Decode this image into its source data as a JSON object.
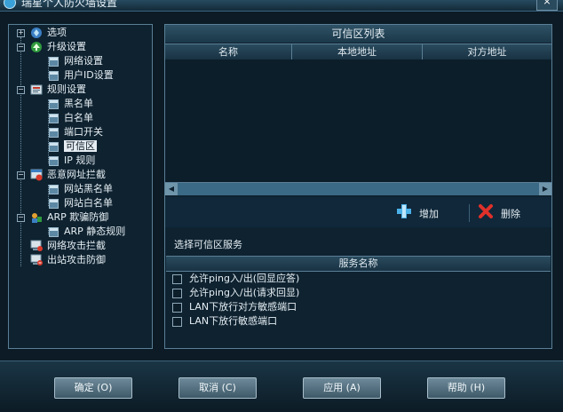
{
  "window": {
    "title": "瑞星个人防火墙设置",
    "close_label": "×"
  },
  "tree": {
    "items": [
      {
        "label": "选项",
        "expander": "+"
      },
      {
        "label": "升级设置",
        "expander": "−"
      },
      {
        "label": "网络设置"
      },
      {
        "label": "用户ID设置"
      },
      {
        "label": "规则设置",
        "expander": "−"
      },
      {
        "label": "黑名单"
      },
      {
        "label": "白名单"
      },
      {
        "label": "端口开关"
      },
      {
        "label": "可信区"
      },
      {
        "label": "IP 规则"
      },
      {
        "label": "恶意网址拦截",
        "expander": "−"
      },
      {
        "label": "网站黑名单"
      },
      {
        "label": "网站白名单"
      },
      {
        "label": "ARP 欺骗防御",
        "expander": "−"
      },
      {
        "label": "ARP 静态规则"
      },
      {
        "label": "网络攻击拦截"
      },
      {
        "label": "出站攻击防御"
      }
    ]
  },
  "trusted_list": {
    "title": "可信区列表",
    "columns": [
      "名称",
      "本地地址",
      "对方地址"
    ]
  },
  "actions": {
    "add_label": "增加",
    "delete_label": "删除"
  },
  "services": {
    "title": "选择可信区服务",
    "header": "服务名称",
    "items": [
      {
        "label": "允许ping入/出(回显应答)",
        "checked": false
      },
      {
        "label": "允许ping入/出(请求回显)",
        "checked": false
      },
      {
        "label": "LAN下放行对方敏感端口",
        "checked": false
      },
      {
        "label": "LAN下放行敏感端口",
        "checked": false
      }
    ]
  },
  "footer": {
    "ok_label": "确定 (O)",
    "cancel_label": "取消 (C)",
    "apply_label": "应用 (A)",
    "help_label": "帮助 (H)"
  },
  "colors": {
    "background": "#0c1b25",
    "panel": "#0e2230",
    "border": "#5a7f96",
    "scroll": "#3a6a86"
  }
}
